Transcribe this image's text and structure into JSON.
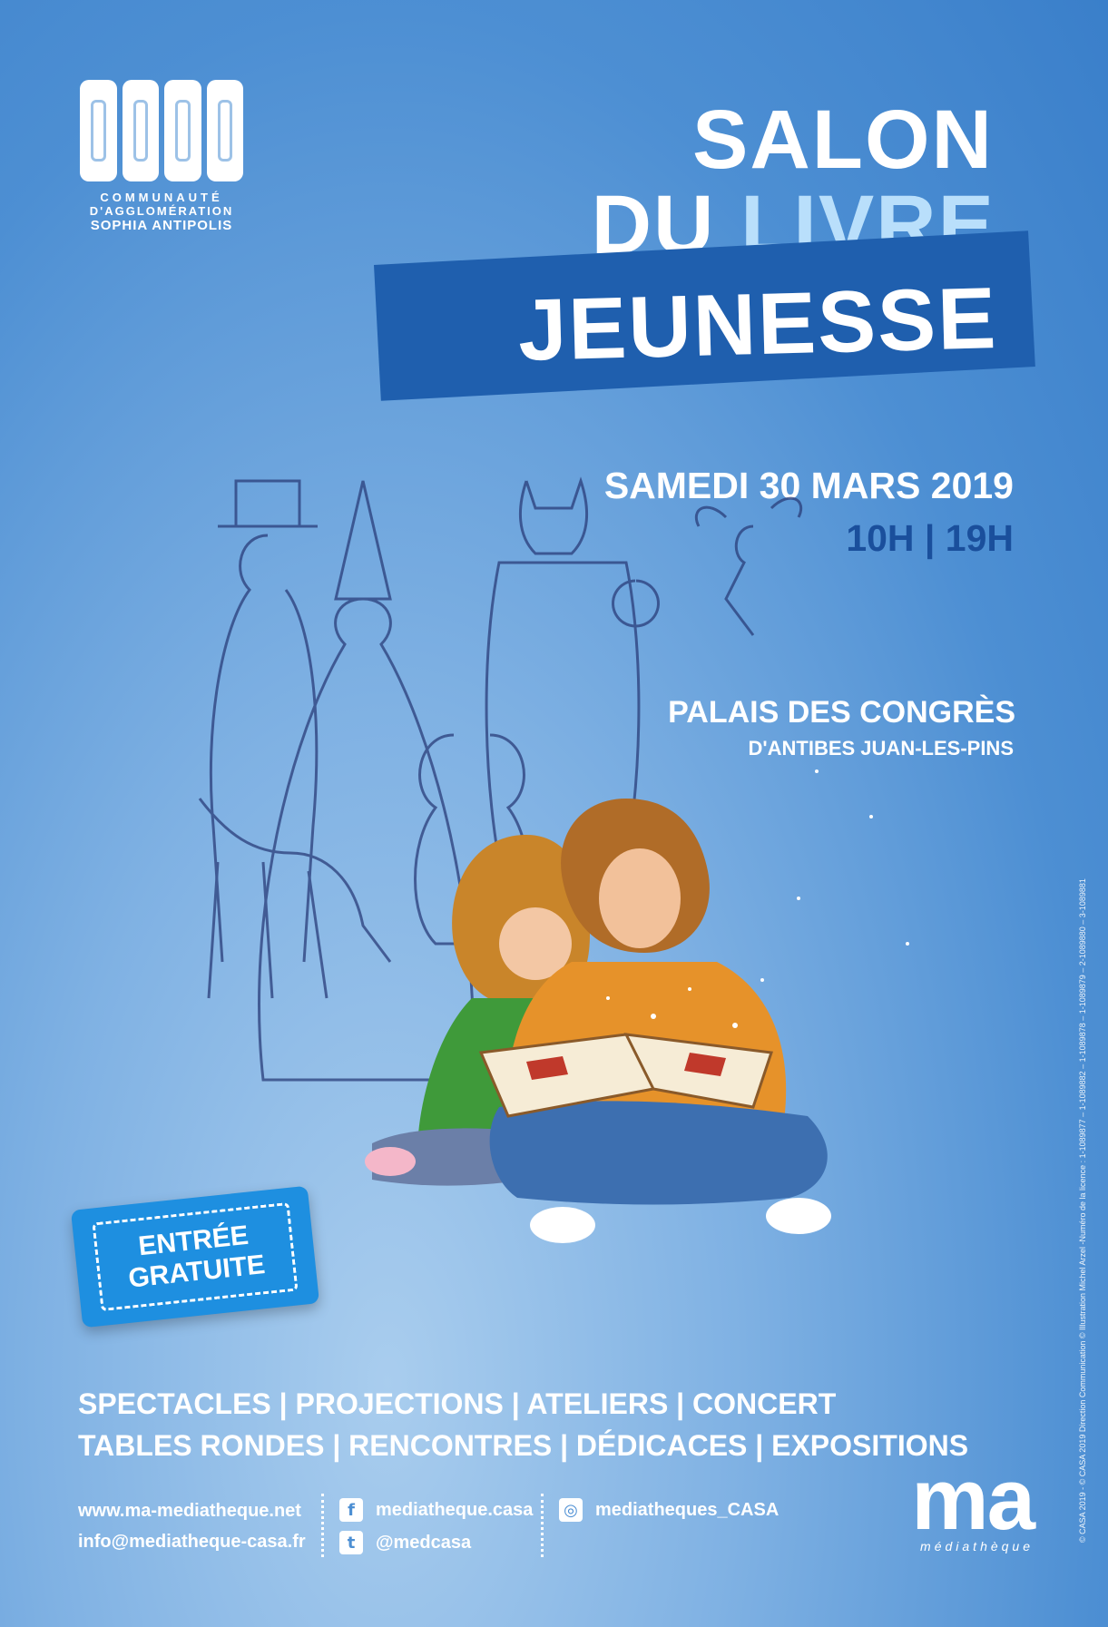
{
  "logo": {
    "line1": "COMMUNAUTÉ",
    "line2": "D'AGGLOMÉRATION",
    "line3": "SOPHIA ANTIPOLIS"
  },
  "title": {
    "line1": "SALON",
    "du": "DU",
    "livre": "LIVRE",
    "line3": "JEUNESSE"
  },
  "event": {
    "date": "SAMEDI 30 MARS 2019",
    "hours": "10H | 19H",
    "venue": "PALAIS DES CONGRÈS",
    "venue_sub": "D'ANTIBES JUAN-LES-PINS"
  },
  "ticket": {
    "line1": "ENTRÉE",
    "line2": "GRATUITE"
  },
  "activities": {
    "line1": "SPECTACLES | PROJECTIONS | ATELIERS | CONCERT",
    "line2": "TABLES RONDES | RENCONTRES | DÉDICACES | EXPOSITIONS"
  },
  "contact": {
    "website": "www.ma-mediatheque.net",
    "email": "info@mediatheque-casa.fr",
    "facebook": "mediatheque.casa",
    "twitter": "@medcasa",
    "instagram": "mediatheques_CASA"
  },
  "brand": {
    "ma": "ma",
    "mediatheque": "médiathèque"
  },
  "credit": "© CASA 2019 - © CASA 2019  Direction Communication © Illustration Michel Arzel -Numéro de la licence : 1-1089877 – 1-1089882 – 1-1089878 – 1-1089879 – 2-1089880 – 3-1089881",
  "colors": {
    "background": "#4d8fd3",
    "band": "#1f5fae",
    "livre": "#b9dffb",
    "hours": "#1a4f9c",
    "ticket": "#1e8fe0"
  }
}
